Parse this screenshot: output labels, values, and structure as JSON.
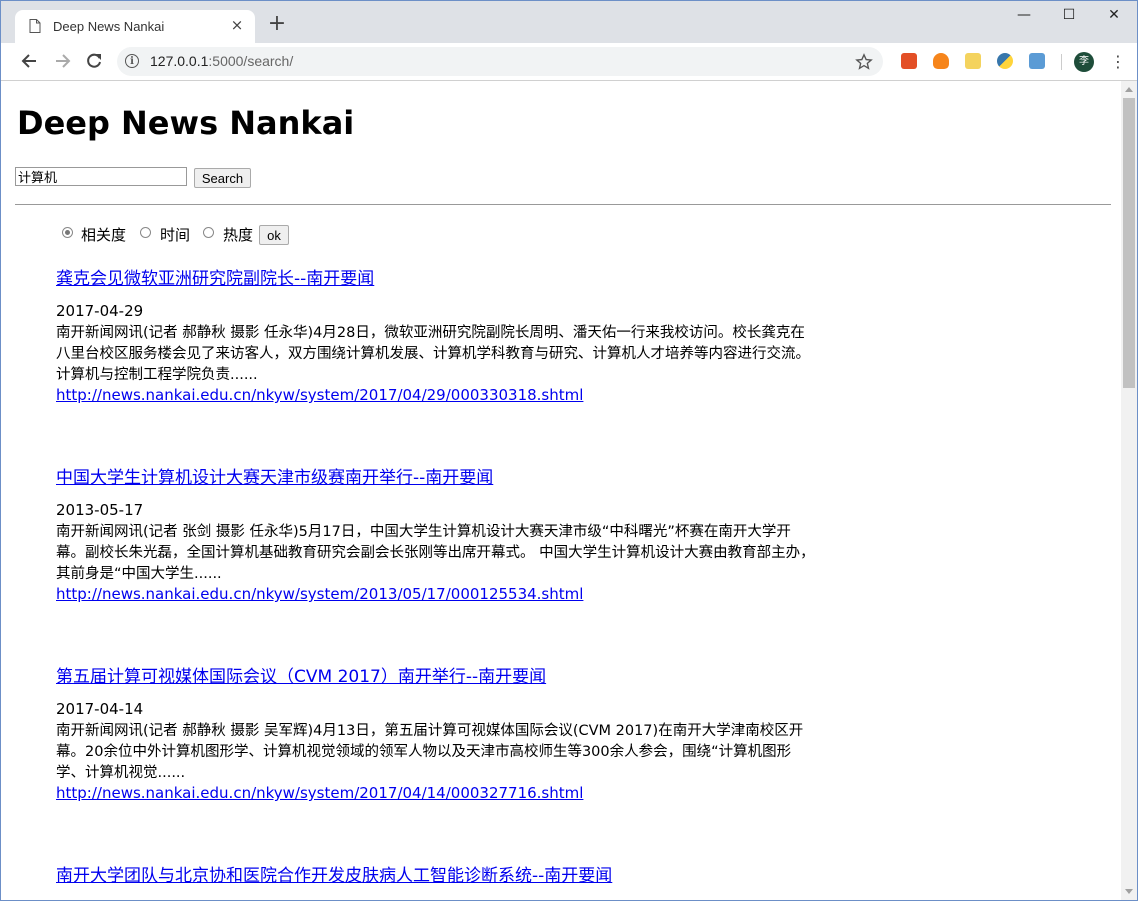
{
  "browser": {
    "tab_title": "Deep News Nankai",
    "tab_close": "×",
    "new_tab": "+",
    "url_host": "127.0.0.1",
    "url_path": ":5000/search/",
    "profile_initial": "李",
    "window_controls": [
      "—",
      "☐",
      "✕"
    ]
  },
  "page": {
    "title": "Deep News Nankai",
    "search_value": "计算机",
    "search_button": "Search",
    "sort_options": [
      "相关度",
      "时间",
      "热度"
    ],
    "sort_selected": "相关度",
    "ok_button": "ok"
  },
  "results": [
    {
      "title": "龚克会见微软亚洲研究院副院长--南开要闻",
      "date": "2017-04-29",
      "snippet": "南开新闻网讯(记者 郝静秋 摄影 任永华)4月28日，微软亚洲研究院副院长周明、潘天佑一行来我校访问。校长龚克在八里台校区服务楼会见了来访客人，双方围绕计算机发展、计算机学科教育与研究、计算机人才培养等内容进行交流。计算机与控制工程学院负责......",
      "url": "http://news.nankai.edu.cn/nkyw/system/2017/04/29/000330318.shtml"
    },
    {
      "title": "中国大学生计算机设计大赛天津市级赛南开举行--南开要闻",
      "date": "2013-05-17",
      "snippet": "南开新闻网讯(记者 张剑 摄影 任永华)5月17日，中国大学生计算机设计大赛天津市级“中科曙光”杯赛在南开大学开幕。副校长朱光磊，全国计算机基础教育研究会副会长张刚等出席开幕式。 中国大学生计算机设计大赛由教育部主办，其前身是“中国大学生......",
      "url": "http://news.nankai.edu.cn/nkyw/system/2013/05/17/000125534.shtml"
    },
    {
      "title": "第五届计算可视媒体国际会议（CVM 2017）南开举行--南开要闻",
      "date": "2017-04-14",
      "snippet": "南开新闻网讯(记者 郝静秋 摄影 吴军辉)4月13日，第五届计算可视媒体国际会议(CVM 2017)在南开大学津南校区开幕。20余位中外计算机图形学、计算机视觉领域的领军人物以及天津市高校师生等300余人参会，围绕“计算机图形学、计算机视觉......",
      "url": "http://news.nankai.edu.cn/nkyw/system/2017/04/14/000327716.shtml"
    },
    {
      "title": "南开大学团队与北京协和医院合作开发皮肤病人工智能诊断系统--南开要闻",
      "date": "",
      "snippet": "",
      "url": ""
    }
  ]
}
